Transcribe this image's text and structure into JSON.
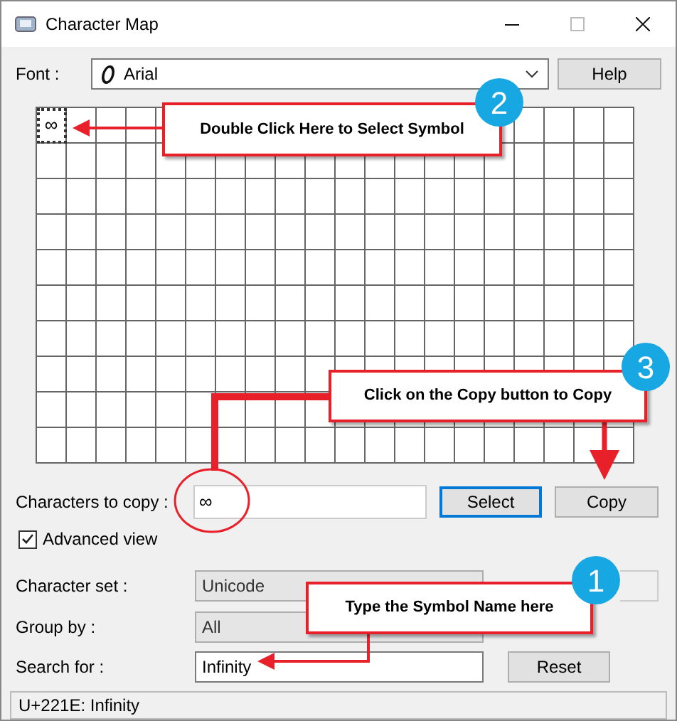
{
  "window": {
    "title": "Character Map"
  },
  "font": {
    "label": "Font :",
    "value": "Arial"
  },
  "help_button": "Help",
  "grid": {
    "cells": [
      {
        "char": "∞",
        "selected": true
      }
    ]
  },
  "copy_row": {
    "label": "Characters to copy :",
    "value": "∞",
    "select_button": "Select",
    "copy_button": "Copy"
  },
  "advanced_view": {
    "label": "Advanced view",
    "checked": true
  },
  "character_set": {
    "label": "Character set :",
    "value": "Unicode",
    "disabled": true
  },
  "group_by": {
    "label": "Group by :",
    "value": "All",
    "disabled": true
  },
  "search": {
    "label": "Search for :",
    "value": "Infinity",
    "reset_button": "Reset"
  },
  "status_bar": "U+221E: Infinity",
  "callouts": [
    {
      "number": "2",
      "text": "Double Click Here to Select Symbol"
    },
    {
      "number": "3",
      "text": "Click on the Copy button to Copy"
    },
    {
      "number": "1",
      "text": "Type the Symbol Name here"
    }
  ]
}
